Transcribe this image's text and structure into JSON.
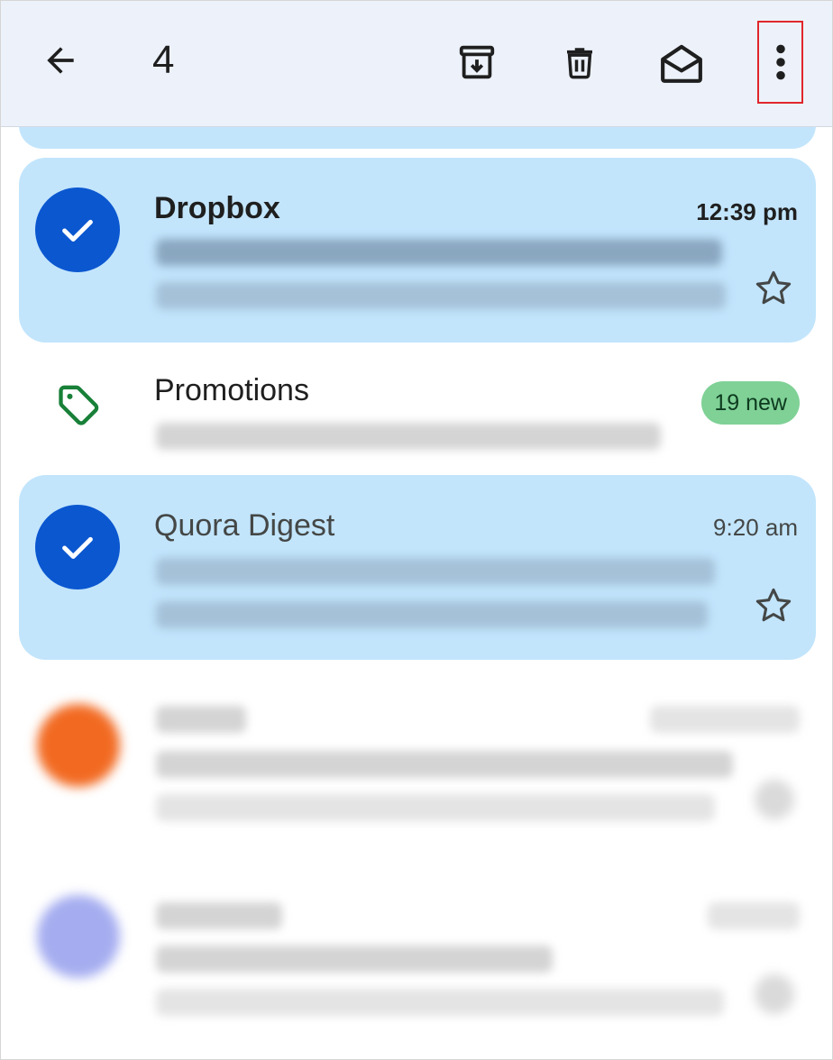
{
  "toolbar": {
    "selected_count": "4",
    "icons": {
      "back": "arrow-back-icon",
      "archive": "archive-icon",
      "delete": "trash-icon",
      "mark_read": "envelope-open-icon",
      "more": "more-vertical-icon"
    },
    "highlight_color": "#e0262a"
  },
  "colors": {
    "toolbar_bg": "#edf2fa",
    "selected_row_bg": "#c2e5fc",
    "check_avatar": "#0b57d0",
    "promotions_tag": "#188038",
    "badge_bg": "#7fd196"
  },
  "emails": [
    {
      "sender": "Dropbox",
      "time": "12:39 pm",
      "unread": true,
      "selected": true,
      "starred": false
    },
    {
      "sender": "Quora Digest",
      "time": "9:20 am",
      "unread": false,
      "selected": true,
      "starred": false
    }
  ],
  "promotions": {
    "label": "Promotions",
    "badge": "19 new"
  }
}
